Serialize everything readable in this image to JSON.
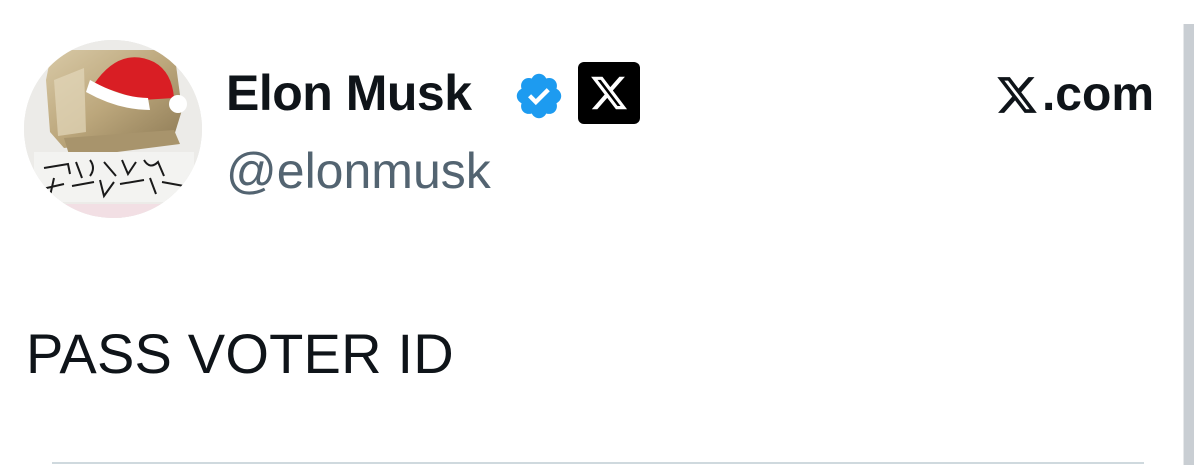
{
  "profile": {
    "display_name": "Elon Musk",
    "handle": "@elonmusk",
    "verified": true,
    "verified_color": "#1d9bf0",
    "affiliation_badge_icon": "x-logo-icon"
  },
  "brand": {
    "text": ".com",
    "icon": "x-logo-icon"
  },
  "avatar": {
    "icon": "avatar-santa-hat-image",
    "signature_text": "THE FUTURE IS AUTONOMOUS"
  },
  "tweet": {
    "text": "PASS VOTER ID"
  },
  "colors": {
    "text_primary": "#0f1419",
    "text_secondary": "#536471",
    "divider": "#cfd9de"
  }
}
